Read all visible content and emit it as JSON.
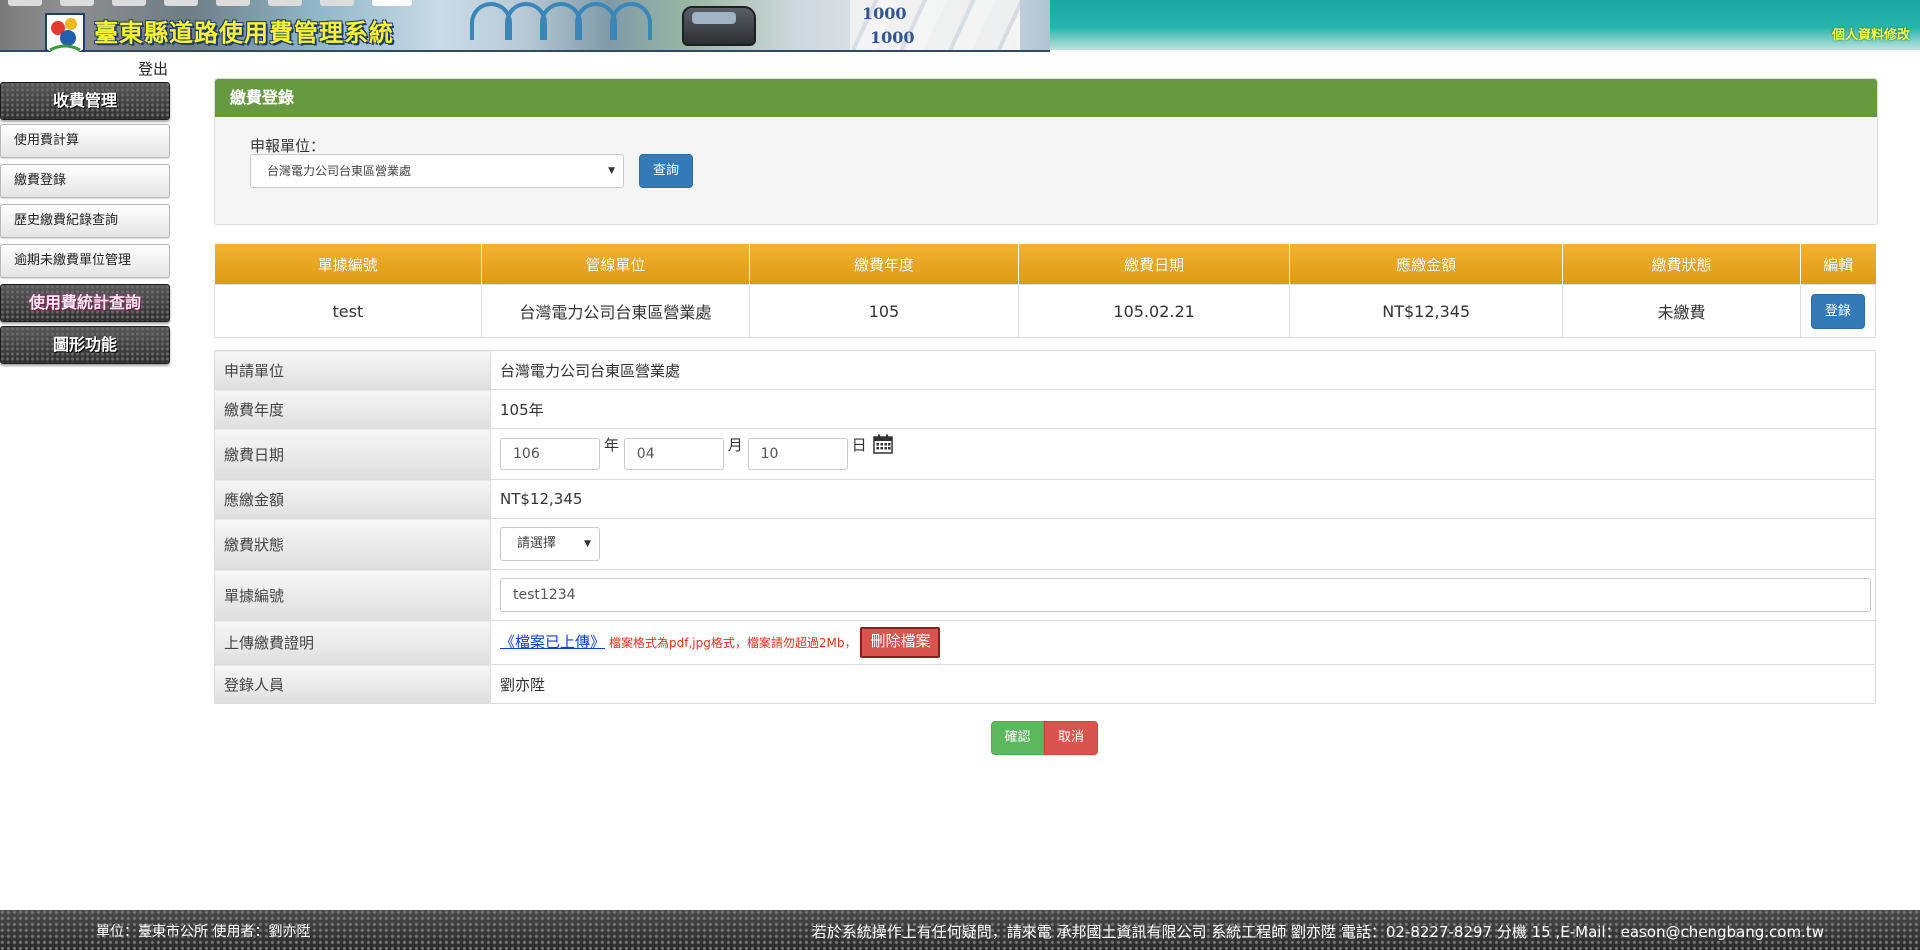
{
  "header": {
    "site_title": "臺東縣道路使用費管理系統",
    "profile_link": "個人資料修改",
    "banner_bills_text": "1000"
  },
  "sidebar": {
    "logout": "登出",
    "sections": [
      {
        "label": "收費管理"
      },
      {
        "label": "使用費統計查詢"
      },
      {
        "label": "圖形功能"
      }
    ],
    "items": [
      {
        "label": "使用費計算"
      },
      {
        "label": "繳費登錄"
      },
      {
        "label": "歷史繳費紀錄查詢"
      },
      {
        "label": "逾期未繳費單位管理"
      }
    ]
  },
  "panel": {
    "title": "繳費登錄",
    "unit_label": "申報單位：",
    "unit_selected": "台灣電力公司台東區營業處",
    "query_button": "查詢"
  },
  "record_table": {
    "columns": [
      "單據編號",
      "管線單位",
      "繳費年度",
      "繳費日期",
      "應繳金額",
      "繳費狀態",
      "編輯"
    ],
    "rows": [
      {
        "receipt_no": "test",
        "unit": "台灣電力公司台東區營業處",
        "year": "105",
        "date": "105.02.21",
        "amount": "NT$12,345",
        "status": "未繳費",
        "edit_button": "登錄"
      }
    ]
  },
  "form": {
    "applicant_label": "申請單位",
    "applicant_value": "台灣電力公司台東區營業處",
    "year_label": "繳費年度",
    "year_value": "105年",
    "date_label": "繳費日期",
    "date_year": "106",
    "date_year_unit": "年",
    "date_month": "04",
    "date_month_unit": "月",
    "date_day": "10",
    "date_day_unit": "日",
    "amount_label": "應繳金額",
    "amount_value": "NT$12,345",
    "status_label": "繳費狀態",
    "status_selected": "請選擇",
    "receipt_label": "單據編號",
    "receipt_value": "test1234",
    "upload_label": "上傳繳費證明",
    "upload_link": "《檔案已上傳》",
    "upload_note": "檔案格式為pdf,jpg格式，檔案請勿超過2Mb，",
    "delete_button": "刪除檔案",
    "operator_label": "登錄人員",
    "operator_value": "劉亦陞"
  },
  "actions": {
    "confirm": "確認",
    "cancel": "取消"
  },
  "footer": {
    "left": "單位：臺東市公所 使用者：劉亦陞",
    "right": "若於系統操作上有任何疑問，請來電 承邦國土資訊有限公司 系統工程師 劉亦陞 電話：02-8227-8297 分機 15 ,E-Mail：eason@chengbang.com.tw"
  },
  "colors": {
    "panel_title_bg": "#669940",
    "table_header_bg": "#dd9a13",
    "primary_button": "#337ab7",
    "success_button": "#5cb85c",
    "danger_button": "#d9534f",
    "title_text": "#fff230"
  }
}
